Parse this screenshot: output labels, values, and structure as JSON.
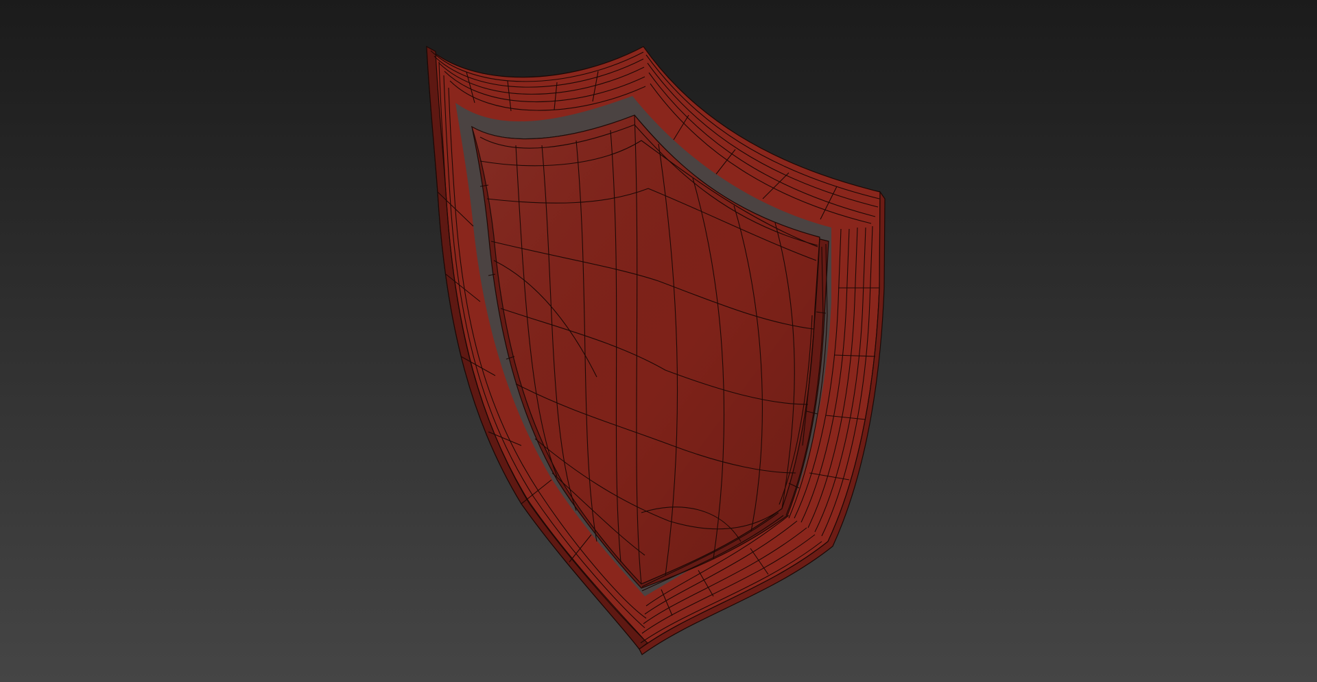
{
  "scene": {
    "subject": "shield-mesh",
    "render_mode": "shaded-with-wireframe"
  },
  "colors": {
    "background_top": "#1b1b1b",
    "background_bottom": "#454545",
    "shield_face": "#7e2219",
    "shield_frame": "#8a261c",
    "shield_frame_side": "#5e1812",
    "shield_frame_bottom": "#6c1c15",
    "inner_edge": "#641a14",
    "wire": "#1c0805"
  }
}
